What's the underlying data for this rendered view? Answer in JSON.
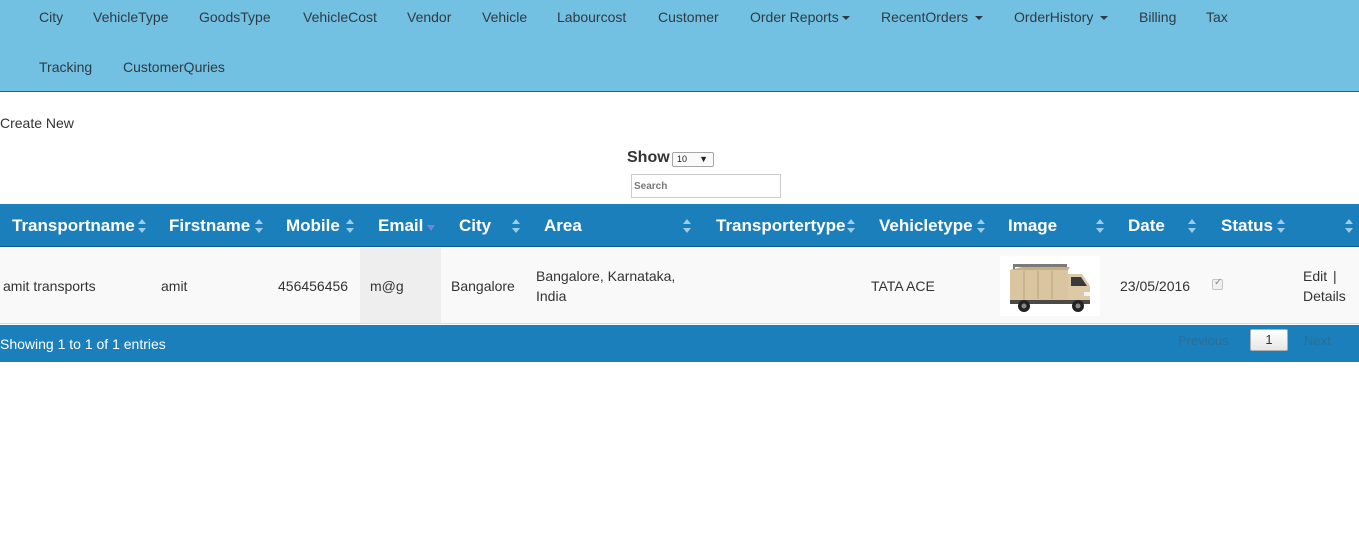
{
  "nav": {
    "items": [
      {
        "label": "City",
        "dropdown": false
      },
      {
        "label": "VehicleType",
        "dropdown": false
      },
      {
        "label": "GoodsType",
        "dropdown": false
      },
      {
        "label": "VehicleCost",
        "dropdown": false
      },
      {
        "label": "Vendor",
        "dropdown": false
      },
      {
        "label": "Vehicle",
        "dropdown": false
      },
      {
        "label": "Labourcost",
        "dropdown": false
      },
      {
        "label": "Customer",
        "dropdown": false
      },
      {
        "label": "Order Reports",
        "dropdown": true
      },
      {
        "label": "RecentOrders",
        "dropdown": true
      },
      {
        "label": "OrderHistory",
        "dropdown": true
      },
      {
        "label": "Billing",
        "dropdown": false
      },
      {
        "label": "Tax",
        "dropdown": false
      },
      {
        "label": "Tracking",
        "dropdown": false
      },
      {
        "label": "CustomerQuries",
        "dropdown": false
      }
    ]
  },
  "actions": {
    "create_new": "Create New"
  },
  "controls": {
    "show_label": "Show",
    "page_size": "10",
    "search_placeholder": "Search"
  },
  "table": {
    "columns": [
      {
        "label": "Transportname",
        "sorted": false
      },
      {
        "label": "Firstname",
        "sorted": false
      },
      {
        "label": "Mobile",
        "sorted": false
      },
      {
        "label": "Email",
        "sorted": true
      },
      {
        "label": "City",
        "sorted": false
      },
      {
        "label": "Area",
        "sorted": false
      },
      {
        "label": "Transportertype",
        "sorted": false
      },
      {
        "label": "Vehicletype",
        "sorted": false
      },
      {
        "label": "Image",
        "sorted": false
      },
      {
        "label": "Date",
        "sorted": false
      },
      {
        "label": "Status",
        "sorted": false
      },
      {
        "label": "",
        "sorted": false
      }
    ],
    "rows": [
      {
        "transportname": "amit transports",
        "firstname": "amit",
        "mobile": "456456456",
        "email": "m@g",
        "city": "Bangalore",
        "area": "Bangalore, Karnataka, India",
        "transportertype": "",
        "vehicletype": "TATA ACE",
        "image": "truck-image",
        "date": "23/05/2016",
        "status_checked": true,
        "edit_label": "Edit",
        "separator": "|",
        "details_label": "Details"
      }
    ]
  },
  "footer": {
    "info": "Showing 1 to 1 of 1 entries",
    "previous_label": "Previous",
    "current_page": "1",
    "next_label": "Next"
  },
  "colors": {
    "navbar": "#72c0e2",
    "table_header": "#1a7fba",
    "row_bg": "#f9f9f9",
    "sorted_col_bg": "#eeeeee"
  }
}
